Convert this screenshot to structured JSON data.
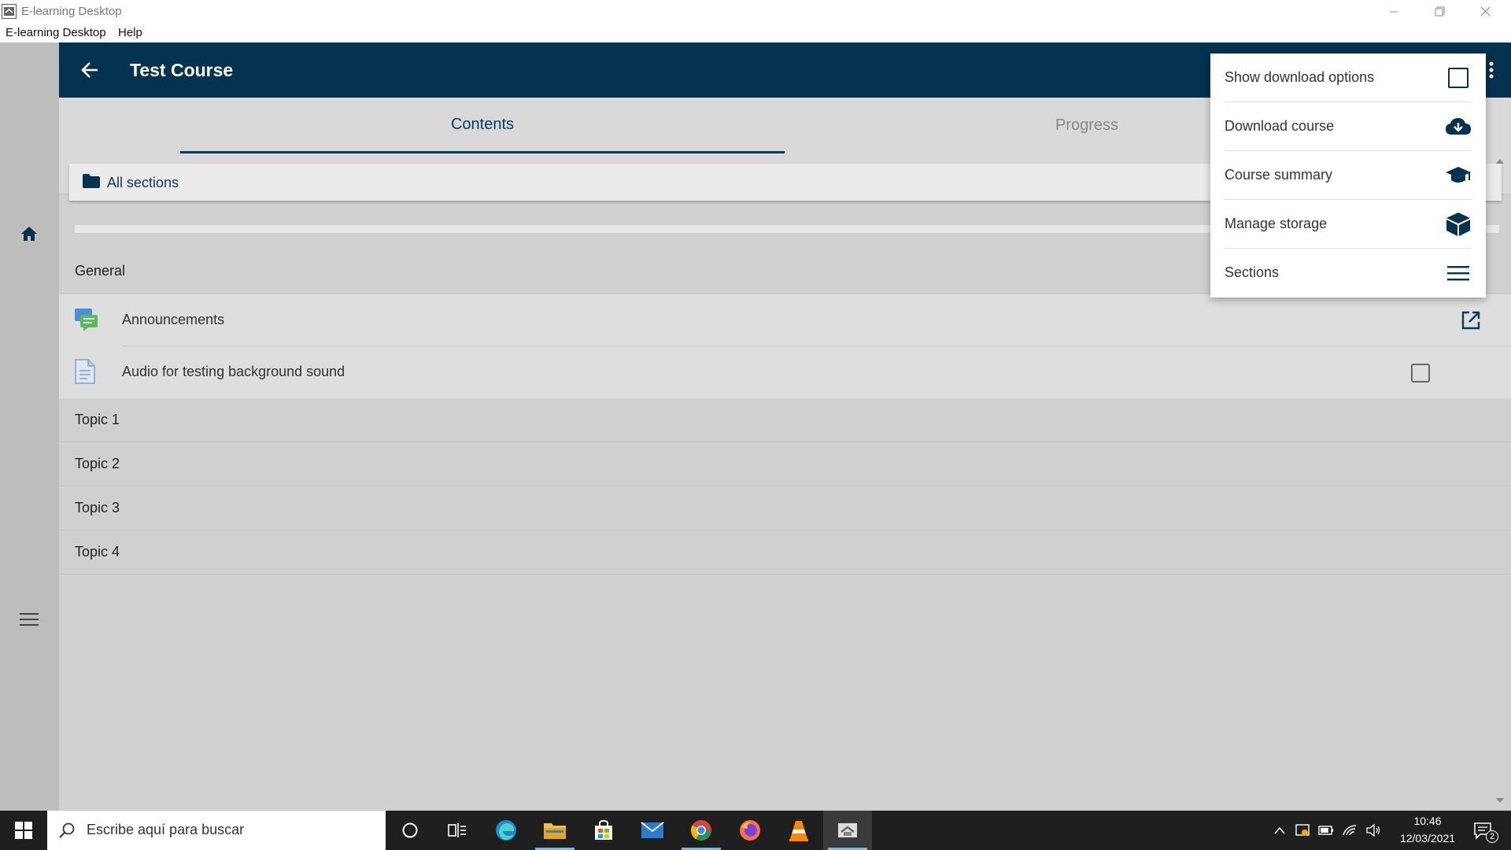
{
  "window": {
    "title": "E-learning Desktop"
  },
  "menubar": {
    "items": [
      "E-learning Desktop",
      "Help"
    ]
  },
  "header": {
    "title": "Test Course"
  },
  "tabs": [
    {
      "label": "Contents",
      "active": true
    },
    {
      "label": "Progress",
      "active": false
    }
  ],
  "sections_selector": {
    "label": "All sections"
  },
  "sections": [
    {
      "name": "General",
      "modules": [
        {
          "label": "Announcements",
          "icon": "forum-icon",
          "action": "open-external-icon"
        },
        {
          "label": "Audio for testing background sound",
          "icon": "file-icon",
          "action": "checkbox"
        }
      ]
    },
    {
      "name": "Topic 1"
    },
    {
      "name": "Topic 2"
    },
    {
      "name": "Topic 3"
    },
    {
      "name": "Topic 4"
    }
  ],
  "popup_menu": {
    "items": [
      {
        "label": "Show download options",
        "icon": "checkbox-icon"
      },
      {
        "label": "Download course",
        "icon": "cloud-download-icon"
      },
      {
        "label": "Course summary",
        "icon": "graduation-cap-icon"
      },
      {
        "label": "Manage storage",
        "icon": "cube-icon"
      },
      {
        "label": "Sections",
        "icon": "menu-lines-icon"
      }
    ]
  },
  "taskbar": {
    "search_placeholder": "Escribe aquí para buscar",
    "clock_time": "10:46",
    "clock_date": "12/03/2021",
    "notification_count": "2"
  },
  "colors": {
    "header": "#04324f",
    "accent": "#0a3a5a",
    "sidebar": "#bdbdbd",
    "content": "#d0d0d0"
  }
}
